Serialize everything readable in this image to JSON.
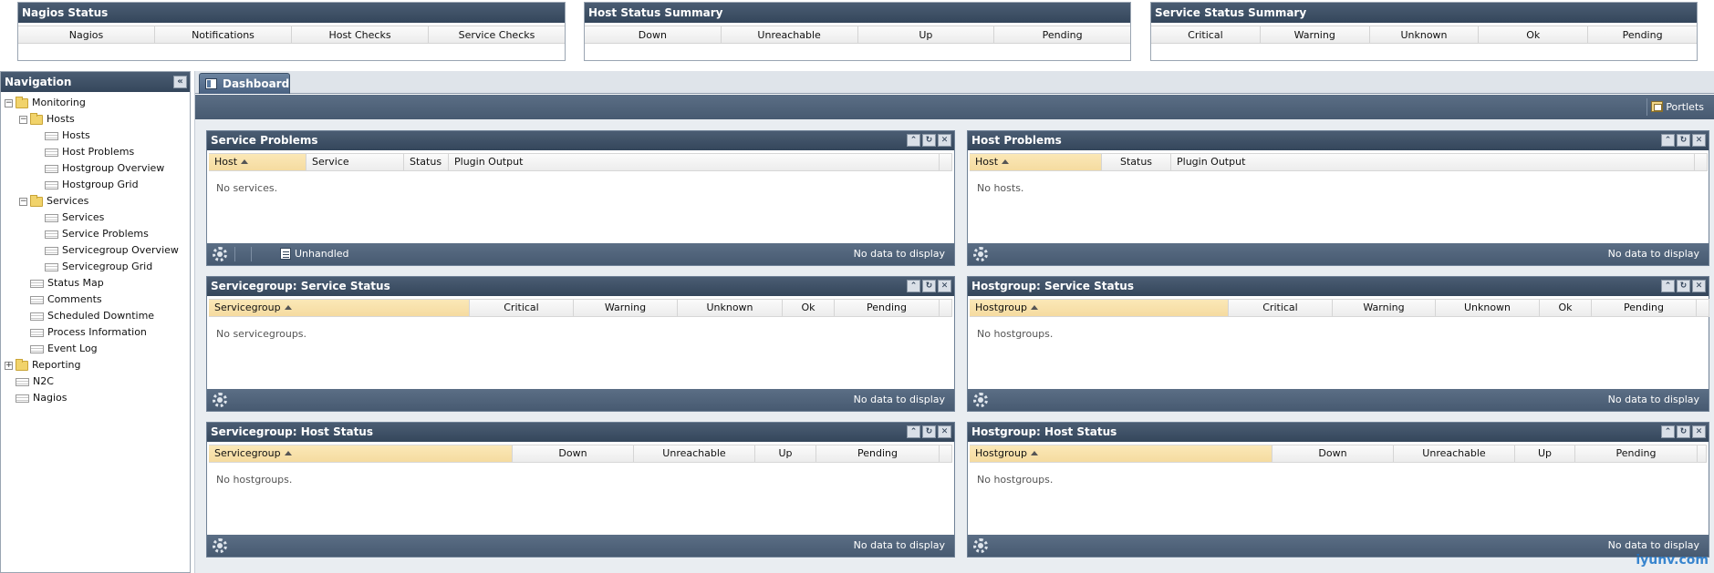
{
  "summary": {
    "nagios_status": {
      "title": "Nagios Status",
      "cols": [
        "Nagios",
        "Notifications",
        "Host Checks",
        "Service Checks"
      ]
    },
    "host_status": {
      "title": "Host Status Summary",
      "cols": [
        "Down",
        "Unreachable",
        "Up",
        "Pending"
      ]
    },
    "service_status": {
      "title": "Service Status Summary",
      "cols": [
        "Critical",
        "Warning",
        "Unknown",
        "Ok",
        "Pending"
      ]
    }
  },
  "navigation": {
    "title": "Navigation",
    "items": [
      {
        "label": "Monitoring",
        "toggle": "−"
      },
      {
        "label": "Hosts",
        "toggle": "−"
      },
      {
        "label": "Hosts"
      },
      {
        "label": "Host Problems"
      },
      {
        "label": "Hostgroup Overview"
      },
      {
        "label": "Hostgroup Grid"
      },
      {
        "label": "Services",
        "toggle": "−"
      },
      {
        "label": "Services"
      },
      {
        "label": "Service Problems"
      },
      {
        "label": "Servicegroup Overview"
      },
      {
        "label": "Servicegroup Grid"
      },
      {
        "label": "Status Map"
      },
      {
        "label": "Comments"
      },
      {
        "label": "Scheduled Downtime"
      },
      {
        "label": "Process Information"
      },
      {
        "label": "Event Log"
      },
      {
        "label": "Reporting",
        "toggle": "+"
      },
      {
        "label": "N2C"
      },
      {
        "label": "Nagios"
      }
    ]
  },
  "tab": {
    "label": "Dashboard"
  },
  "toolbar": {
    "portlets_label": "Portlets"
  },
  "portlets": {
    "service_problems": {
      "title": "Service Problems",
      "cols": [
        "Host",
        "Service",
        "Status",
        "Plugin Output"
      ],
      "empty": "No services.",
      "unhandled": "Unhandled",
      "footer": "No data to display"
    },
    "host_problems": {
      "title": "Host Problems",
      "cols": [
        "Host",
        "Status",
        "Plugin Output"
      ],
      "empty": "No hosts.",
      "footer": "No data to display"
    },
    "sg_service_status": {
      "title": "Servicegroup: Service Status",
      "cols": [
        "Servicegroup",
        "Critical",
        "Warning",
        "Unknown",
        "Ok",
        "Pending"
      ],
      "empty": "No servicegroups.",
      "footer": "No data to display"
    },
    "hg_service_status": {
      "title": "Hostgroup: Service Status",
      "cols": [
        "Hostgroup",
        "Critical",
        "Warning",
        "Unknown",
        "Ok",
        "Pending"
      ],
      "empty": "No hostgroups.",
      "footer": "No data to display"
    },
    "sg_host_status": {
      "title": "Servicegroup: Host Status",
      "cols": [
        "Servicegroup",
        "Down",
        "Unreachable",
        "Up",
        "Pending"
      ],
      "empty": "No hostgroups.",
      "footer": "No data to display"
    },
    "hg_host_status": {
      "title": "Hostgroup: Host Status",
      "cols": [
        "Hostgroup",
        "Down",
        "Unreachable",
        "Up",
        "Pending"
      ],
      "empty": "No hostgroups.",
      "footer": "No data to display"
    }
  },
  "watermark": "iyunv.com"
}
